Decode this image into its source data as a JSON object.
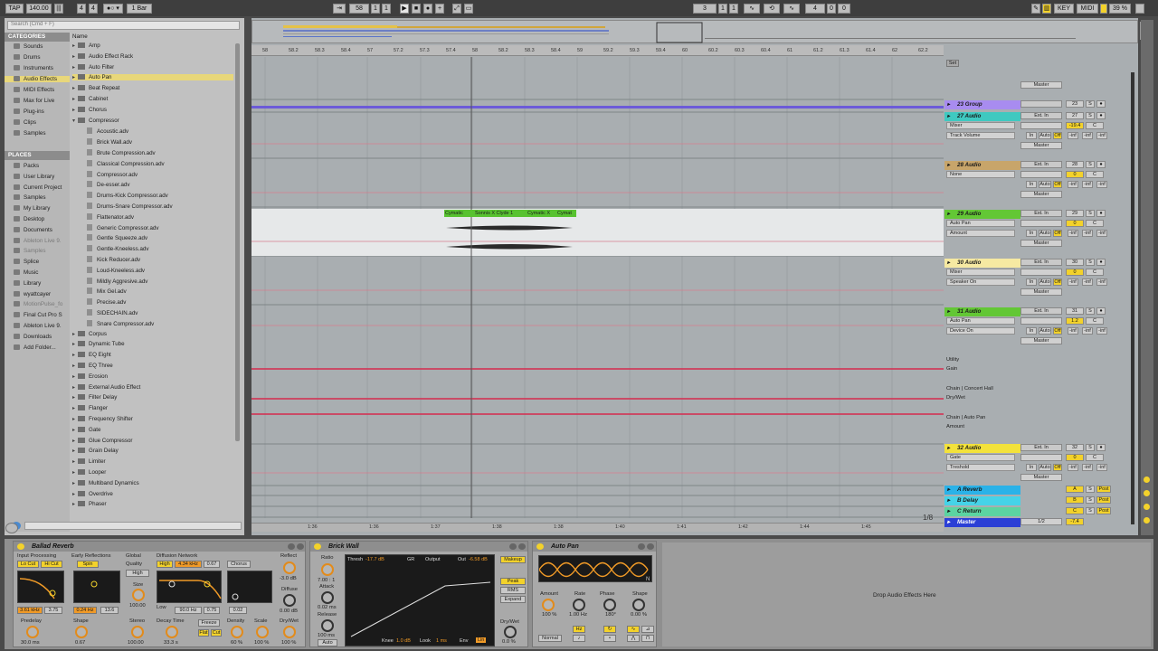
{
  "transport": {
    "tap": "TAP",
    "tempo": "140.00",
    "time_sig_num": "4",
    "time_sig_den": "4",
    "quantize": "1 Bar",
    "position": [
      "58",
      "1",
      "1"
    ],
    "loop_start": [
      "3",
      "1",
      "1"
    ],
    "loop_length": [
      "4",
      "0",
      "0"
    ],
    "key": "KEY",
    "midi": "MIDI",
    "cpu": "39 %"
  },
  "browser": {
    "search_placeholder": "Search (Cmd + F)",
    "categories_title": "CATEGORIES",
    "categories": [
      "Sounds",
      "Drums",
      "Instruments",
      "Audio Effects",
      "MIDI Effects",
      "Max for Live",
      "Plug-ins",
      "Clips",
      "Samples"
    ],
    "places_title": "PLACES",
    "places": [
      "Packs",
      "User Library",
      "Current Project",
      "Samples",
      "My Library",
      "Desktop",
      "Documents",
      "Ableton Live 9.",
      "Samples",
      "Splice",
      "Music",
      "Library",
      "wyattcayer",
      "MotionPulse_fo",
      "Final Cut Pro S",
      "Ableton Live 9.",
      "Downloads",
      "Add Folder..."
    ],
    "name_header": "Name",
    "items": [
      {
        "label": "Amp",
        "kind": "folder"
      },
      {
        "label": "Audio Effect Rack",
        "kind": "folder"
      },
      {
        "label": "Auto Filter",
        "kind": "folder"
      },
      {
        "label": "Auto Pan",
        "kind": "folder"
      },
      {
        "label": "Beat Repeat",
        "kind": "folder"
      },
      {
        "label": "Cabinet",
        "kind": "folder"
      },
      {
        "label": "Chorus",
        "kind": "folder"
      },
      {
        "label": "Compressor",
        "kind": "open"
      },
      {
        "label": "Acoustic.adv",
        "kind": "file"
      },
      {
        "label": "Brick Wall.adv",
        "kind": "file"
      },
      {
        "label": "Brute Compression.adv",
        "kind": "file"
      },
      {
        "label": "Classical Compression.adv",
        "kind": "file"
      },
      {
        "label": "Compressor.adv",
        "kind": "file"
      },
      {
        "label": "De-esser.adv",
        "kind": "file"
      },
      {
        "label": "Drums-Kick Compressor.adv",
        "kind": "file"
      },
      {
        "label": "Drums-Snare Compressor.adv",
        "kind": "file"
      },
      {
        "label": "Flattenator.adv",
        "kind": "file"
      },
      {
        "label": "Generic Compressor.adv",
        "kind": "file"
      },
      {
        "label": "Gentle Squeeze.adv",
        "kind": "file"
      },
      {
        "label": "Gentle-Kneeless.adv",
        "kind": "file"
      },
      {
        "label": "Kick Reducer.adv",
        "kind": "file"
      },
      {
        "label": "Loud-Kneeless.adv",
        "kind": "file"
      },
      {
        "label": "Mildly Aggresive.adv",
        "kind": "file"
      },
      {
        "label": "Mix Gel.adv",
        "kind": "file"
      },
      {
        "label": "Precise.adv",
        "kind": "file"
      },
      {
        "label": "SIDECHAIN.adv",
        "kind": "file"
      },
      {
        "label": "Snare Compressor.adv",
        "kind": "file"
      },
      {
        "label": "Corpus",
        "kind": "folder"
      },
      {
        "label": "Dynamic Tube",
        "kind": "folder"
      },
      {
        "label": "EQ Eight",
        "kind": "folder"
      },
      {
        "label": "EQ Three",
        "kind": "folder"
      },
      {
        "label": "Erosion",
        "kind": "folder"
      },
      {
        "label": "External Audio Effect",
        "kind": "folder"
      },
      {
        "label": "Filter Delay",
        "kind": "folder"
      },
      {
        "label": "Flanger",
        "kind": "folder"
      },
      {
        "label": "Frequency Shifter",
        "kind": "folder"
      },
      {
        "label": "Gate",
        "kind": "folder"
      },
      {
        "label": "Glue Compressor",
        "kind": "folder"
      },
      {
        "label": "Grain Delay",
        "kind": "folder"
      },
      {
        "label": "Limiter",
        "kind": "folder"
      },
      {
        "label": "Looper",
        "kind": "folder"
      },
      {
        "label": "Multiband Dynamics",
        "kind": "folder"
      },
      {
        "label": "Overdrive",
        "kind": "folder"
      },
      {
        "label": "Phaser",
        "kind": "folder"
      }
    ]
  },
  "arrangement": {
    "ruler": [
      "58",
      "58.2",
      "58.3",
      "58.4",
      "57",
      "57.2",
      "57.3",
      "57.4",
      "58",
      "58.2",
      "58.3",
      "58.4",
      "59",
      "59.2",
      "59.3",
      "59.4",
      "60",
      "60.2",
      "60.3",
      "60.4",
      "61",
      "61.2",
      "61.3",
      "61.4",
      "62",
      "62.2"
    ],
    "time_ruler": [
      "1:36",
      "1:36",
      "1:37",
      "1:38",
      "1:38",
      "1:40",
      "1:41",
      "1:42",
      "1:44",
      "1:45"
    ],
    "page_indicator": "1/8",
    "clips": [
      "Cymatic",
      "Sonnis X Clyde 1",
      "Cymatic X",
      "Cymat"
    ]
  },
  "tracks": [
    {
      "name": "23 Group",
      "color": "#a88cf0",
      "num": "23",
      "sel1": "",
      "sel2": ""
    },
    {
      "name": "27 Audio",
      "color": "#3fc9c0",
      "num": "27",
      "sel1": "Mixer",
      "sel2": "Track Volume",
      "vol": "-19.4"
    },
    {
      "name": "28 Audio",
      "color": "#c8a56a",
      "num": "28",
      "sel1": "None",
      "sel2": "",
      "vol": "0"
    },
    {
      "name": "29 Audio",
      "color": "#63c735",
      "num": "29",
      "sel1": "Auto Pan",
      "sel2": "Amount",
      "vol": "0"
    },
    {
      "name": "30 Audio",
      "color": "#f6e9a2",
      "num": "30",
      "sel1": "Mixer",
      "sel2": "Speaker On",
      "vol": "0"
    },
    {
      "name": "31 Audio",
      "color": "#63c735",
      "num": "31",
      "sel1": "Auto Pan",
      "sel2": "Device On",
      "vol": "1.2"
    },
    {
      "name": "32 Audio",
      "color": "#f3e23b",
      "num": "32",
      "sel1": "Gate",
      "sel2": "Treshold",
      "vol": "0"
    }
  ],
  "chains": [
    "Utility",
    "Gain",
    "Chain | Concert Hall",
    "Dry/Wet",
    "Chain | Auto Pan",
    "Amount"
  ],
  "returns": [
    {
      "name": "A Reverb",
      "letter": "A",
      "color": "#2ab2e8"
    },
    {
      "name": "B Delay",
      "letter": "B",
      "color": "#45d3e8"
    },
    {
      "name": "C Return",
      "letter": "C",
      "color": "#5bd4a1"
    }
  ],
  "master": {
    "name": "Master",
    "sel": "1/2",
    "vol": "-7.4",
    "color": "#2b3fd6"
  },
  "mixer_labels": {
    "ext_in": "Ext. In",
    "master_out": "Master",
    "in": "In",
    "auto": "Auto",
    "off": "Off",
    "inf": "-inf",
    "s": "S",
    "c": "C",
    "post": "Post",
    "set": "Set"
  },
  "devices": {
    "reverb": {
      "title": "Ballad Reverb",
      "input_processing": "Input Processing",
      "lo_cut": "Lo Cut",
      "hi_cut": "Hi Cut",
      "early_reflections": "Early Reflections",
      "spin": "Spin",
      "global": "Global",
      "quality": "Quality",
      "quality_val": "High",
      "diffusion_network": "Diffusion Network",
      "high": "High",
      "freq": "4.34 kHz",
      "val": "0.67",
      "chorus": "Chorus",
      "low": "Low",
      "low_freq": "90.0 Hz",
      "low_val": "0.75",
      "low_val2": "0.02",
      "reflect": "Reflect",
      "reflect_val": "-3.0 dB",
      "diffuse": "Diffuse",
      "diffuse_val": "0.00 dB",
      "size": "Size",
      "size_val": "100.00",
      "hicut_freq": "3.61 kHz",
      "hicut_val": "3.75",
      "spin_freq": "0.24 Hz",
      "spin_val": "13.6",
      "predelay": "Predelay",
      "predelay_val": "30.0 ms",
      "shape": "Shape",
      "shape_val": "0.67",
      "stereo": "Stereo",
      "stereo_val": "100.00",
      "decay": "Decay Time",
      "decay_val": "33.3 s",
      "freeze": "Freeze",
      "flat": "Flat",
      "cut": "Cut",
      "density": "Density",
      "density_val": "60 %",
      "scale": "Scale",
      "scale_val": "100 %",
      "drywet": "Dry/Wet",
      "drywet_val": "100 %"
    },
    "brickwall": {
      "title": "Brick Wall",
      "ratio": "Ratio",
      "ratio_val": "7.00 : 1",
      "attack": "Attack",
      "attack_val": "0.02 ms",
      "release": "Release",
      "release_val": "100 ms",
      "auto": "Auto",
      "thresh": "Thresh",
      "thresh_val": "-17.7 dB",
      "gr": "GR",
      "output": "Output",
      "out": "Out",
      "out_val": "-6.58 dB",
      "makeup": "Makeup",
      "peak": "Peak",
      "rms": "RMS",
      "expand": "Expand",
      "knee": "Knee",
      "knee_val": "1.0 dB",
      "look": "Look",
      "look_val": "1 ms",
      "env": "Env",
      "lin": "Lin",
      "drywet": "Dry/Wet",
      "drywet_val": "0.0 %"
    },
    "autopan": {
      "title": "Auto Pan",
      "amount": "Amount",
      "amount_val": "100 %",
      "rate": "Rate",
      "rate_val": "1.00 Hz",
      "phase": "Phase",
      "phase_val": "180°",
      "shape": "Shape",
      "shape_val": "0.00 %",
      "normal": "Normal",
      "hz": "Hz",
      "n": "N"
    },
    "drop_hint": "Drop Audio Effects Here"
  },
  "colors": {
    "accent": "#f3d22b",
    "selection": "#e8d77a",
    "automation": "#d62a4e"
  }
}
